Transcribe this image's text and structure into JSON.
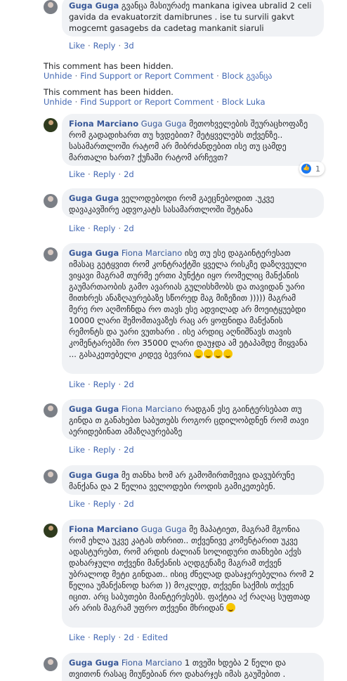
{
  "actions": {
    "like": "Like",
    "reply": "Reply",
    "edited": "Edited",
    "dot": "·"
  },
  "hidden": {
    "note": "This comment has been hidden.",
    "unhide": "Unhide",
    "support": "Find Support or Report Comment",
    "blocks": [
      "Block გვანცა",
      "Block Luka"
    ]
  },
  "comments": [
    {
      "author": "Guga Guga",
      "text": "გვანცა მასიურაძე mankana igivea ubralid 2 celi gavida da evakuatorzit damibrunes . ise tu survili gakvt mogcemt gasagebs da cadetag mankanit siaruli",
      "time": "3d"
    },
    {
      "author": "Fiona Marciano",
      "tag": "Guga Guga",
      "text": "მეთოხველების შეურაცხოფაზე რომ გადადიხართ თუ ხვდებით? მეტყველებს თქვენზე.. სასამართლოში რატომ არ მიბრძანდებით ისე თუ ცამდე მართალი ხართ? ქუჩაში რატომ არჩევთ?",
      "time": "2d",
      "reactions": "1"
    },
    {
      "author": "Guga Guga",
      "text": "ველოდებოდი რომ გაეცნებოდით .უკვე დავაკავშირე ადვოკატს სასამართლოში შეტანა",
      "time": "2d"
    },
    {
      "author": "Guga Guga",
      "tag": "Fiona Marciano",
      "text": "ისე თუ ესე დაგაინტერესათ იმასაც გეტყვით რომ კონტრაქტში ყველა რისკზე დაზღვეული ვიყავი მაგრამ თურმე ერთი პუნქტი იყო რომელიც მანქანის გაუმართაობის გამო ავარიას გულისხმობს და თავიდან უარი მითხრეს ანაზღაურებაზე სწორედ მაგ მიზეზით )))))  მაგრამ მერე რო აღმოჩნდა რო თავს ესე ადვილად არ მოეიტყუებდი 10000 ლარი შემომთავაზეს რაც არ ყოფნიდა მანქანის რემონტს და უარი ვუთხარი . ისე არდიც აღნიშნავს თავის კომენტარებში რო 35000 ლარი დაუჯდა ამ ეტაპამდე მიყვანა ... გასაკეთებელი კიდევ ბევრია",
      "emojis": 4,
      "time": "2d"
    },
    {
      "author": "Guga Guga",
      "tag": "Fiona Marciano",
      "text": "რადგან ესე გაინტერსებათ თუ გინდა თ განახებთ საბუთებს როგორ ცდილობდნენ რომ თავი აერიდებინათ ამაზღაურებაზე",
      "time": "2d"
    },
    {
      "author": "Guga Guga",
      "text": "მე თანხა ხომ არ გამომირთმევია დავუბრუნე მანქანა და 2 წელია ველოდები როდის გამიკეთებენ.",
      "time": "2d"
    },
    {
      "author": "Fiona Marciano",
      "tag": "Guga Guga",
      "text": "მე მაპატიეთ, მაგრამ მგონია რომ ეხლა უკვე კატას თხრით.. თქვენივე კომენტარით უკვე ადასტურებთ, რომ არდის ძალიან სოლიდური თანხები აქვს დახარჯული თქვენი მანქანის აღდგენაზე მაგრამ თქვენ უბრალოდ მეტი გინდათ.. ისიც ძნელად დასაჯერებელია რომ 2 წელია უმანქანოდ ხართ )) მოკლედ, თქვენი საქმის თქვენ იცით. არც საბუთები მაინტერესებს. ფაქტია აქ რაღაც სუფთად არ არის მაგრამ უფრო თქვენი მხრიდან",
      "emojis": 1,
      "time": "2d",
      "edited": true
    },
    {
      "author": "Guga Guga",
      "tag": "Fiona Marciano",
      "text": "1 თვეში ხდება 2 წელი და თვითონ რასაც მიუწებიან რო დახარჯეს იმას გაუშებით .",
      "time": ""
    }
  ]
}
